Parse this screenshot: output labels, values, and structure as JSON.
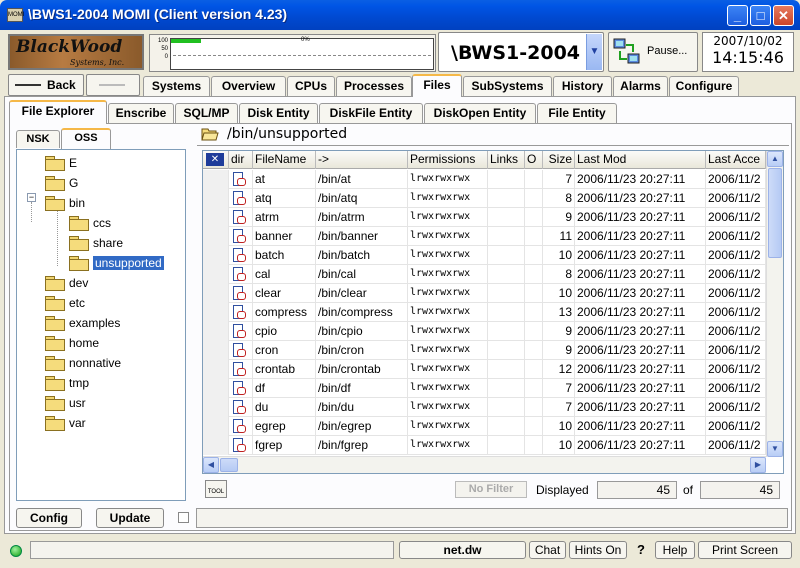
{
  "window": {
    "title": "\\BWS1-2004 MOMI (Client version 4.23)",
    "app_icon_text": "MOMI",
    "min": "_",
    "max": "□",
    "close": "✕"
  },
  "header": {
    "logo_line1": "BlackWood",
    "logo_line2": "Systems, Inc.",
    "chart_axis": [
      "100",
      "50",
      "0"
    ],
    "chart_pct": "0%",
    "chart_level": 0.0,
    "system_name": "\\BWS1-2004",
    "pause_label": "Pause...",
    "date": "2007/10/02",
    "time": "14:15:46"
  },
  "nav": {
    "back": "Back",
    "tabs": [
      "Systems",
      "Overview",
      "CPUs",
      "Processes",
      "Files",
      "SubSystems",
      "History",
      "Alarms",
      "Configure"
    ],
    "active_tab": "Files"
  },
  "subtabs": [
    "File Explorer",
    "Enscribe",
    "SQL/MP",
    "Disk Entity",
    "DiskFile Entity",
    "DiskOpen Entity",
    "File Entity"
  ],
  "left_tabs": [
    "NSK",
    "OSS"
  ],
  "tree": [
    "E",
    "G",
    "bin",
    "ccs",
    "share",
    "unsupported",
    "dev",
    "etc",
    "examples",
    "home",
    "nonnative",
    "tmp",
    "usr",
    "var"
  ],
  "path": "/bin/unsupported",
  "table": {
    "headers": [
      "dir",
      "FileName",
      "->",
      "Permissions",
      "Links",
      "O",
      "Size",
      "Last Mod",
      "Last Acce"
    ],
    "rows": [
      [
        "at",
        "/bin/at",
        "lrwxrwxrwx",
        "7",
        "2006/11/23 20:27:11",
        "2006/11/2"
      ],
      [
        "atq",
        "/bin/atq",
        "lrwxrwxrwx",
        "8",
        "2006/11/23 20:27:11",
        "2006/11/2"
      ],
      [
        "atrm",
        "/bin/atrm",
        "lrwxrwxrwx",
        "9",
        "2006/11/23 20:27:11",
        "2006/11/2"
      ],
      [
        "banner",
        "/bin/banner",
        "lrwxrwxrwx",
        "11",
        "2006/11/23 20:27:11",
        "2006/11/2"
      ],
      [
        "batch",
        "/bin/batch",
        "lrwxrwxrwx",
        "10",
        "2006/11/23 20:27:11",
        "2006/11/2"
      ],
      [
        "cal",
        "/bin/cal",
        "lrwxrwxrwx",
        "8",
        "2006/11/23 20:27:11",
        "2006/11/2"
      ],
      [
        "clear",
        "/bin/clear",
        "lrwxrwxrwx",
        "10",
        "2006/11/23 20:27:11",
        "2006/11/2"
      ],
      [
        "compress",
        "/bin/compress",
        "lrwxrwxrwx",
        "13",
        "2006/11/23 20:27:11",
        "2006/11/2"
      ],
      [
        "cpio",
        "/bin/cpio",
        "lrwxrwxrwx",
        "9",
        "2006/11/23 20:27:11",
        "2006/11/2"
      ],
      [
        "cron",
        "/bin/cron",
        "lrwxrwxrwx",
        "9",
        "2006/11/23 20:27:11",
        "2006/11/2"
      ],
      [
        "crontab",
        "/bin/crontab",
        "lrwxrwxrwx",
        "12",
        "2006/11/23 20:27:11",
        "2006/11/2"
      ],
      [
        "df",
        "/bin/df",
        "lrwxrwxrwx",
        "7",
        "2006/11/23 20:27:11",
        "2006/11/2"
      ],
      [
        "du",
        "/bin/du",
        "lrwxrwxrwx",
        "7",
        "2006/11/23 20:27:11",
        "2006/11/2"
      ],
      [
        "egrep",
        "/bin/egrep",
        "lrwxrwxrwx",
        "10",
        "2006/11/23 20:27:11",
        "2006/11/2"
      ],
      [
        "fgrep",
        "/bin/fgrep",
        "lrwxrwxrwx",
        "10",
        "2006/11/23 20:27:11",
        "2006/11/2"
      ]
    ]
  },
  "footer": {
    "tool_label": "TOOL",
    "no_filter": "No Filter",
    "displayed_label": "Displayed",
    "displayed_value": "45",
    "of_label": "of",
    "total_value": "45"
  },
  "buttons": {
    "config": "Config",
    "update": "Update"
  },
  "statusbar": {
    "net": "net.dw",
    "chat": "Chat",
    "hints": "Hints On",
    "question": "?",
    "help": "Help",
    "print": "Print Screen"
  }
}
